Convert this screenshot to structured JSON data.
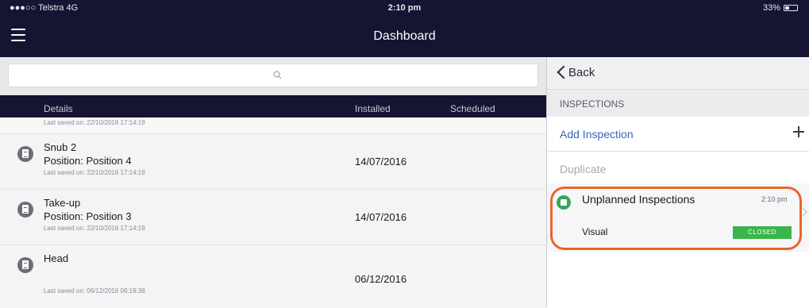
{
  "status_bar": {
    "carrier": "●●●○○ Telstra  4G",
    "time": "2:10 pm",
    "battery": "33%",
    "battery_level": 0.33
  },
  "nav": {
    "title": "Dashboard",
    "menu_icon": "hamburger-menu-icon"
  },
  "search": {
    "icon": "search-icon",
    "placeholder": ""
  },
  "table": {
    "columns": {
      "details": "Details",
      "installed": "Installed",
      "scheduled": "Scheduled"
    },
    "first_saved": "Last saved on: 22/10/2016 17:14:19",
    "rows": [
      {
        "name": "Snub 2",
        "position": "Position: Position 4",
        "saved": "Last saved on: 22/10/2016 17:14:19",
        "installed": "14/07/2016",
        "scheduled": ""
      },
      {
        "name": "Take-up",
        "position": "Position: Position 3",
        "saved": "Last saved on: 22/10/2016 17:14:19",
        "installed": "14/07/2016",
        "scheduled": ""
      },
      {
        "name": "Head",
        "position": "",
        "saved": "Last saved on: 06/12/2016 06:19:38",
        "installed": "06/12/2016",
        "scheduled": ""
      }
    ]
  },
  "right_panel": {
    "back_label": "Back",
    "section_title": "INSPECTIONS",
    "add_label": "Add Inspection",
    "duplicate_label": "Duplicate",
    "inspection": {
      "title": "Unplanned Inspections",
      "time": "2:10 pm",
      "type": "Visual",
      "status": "CLOSED"
    }
  },
  "colors": {
    "nav_background": "#151433",
    "link_blue": "#3b66b8",
    "status_green": "#3bb54a",
    "highlight_orange": "#e9642b"
  }
}
